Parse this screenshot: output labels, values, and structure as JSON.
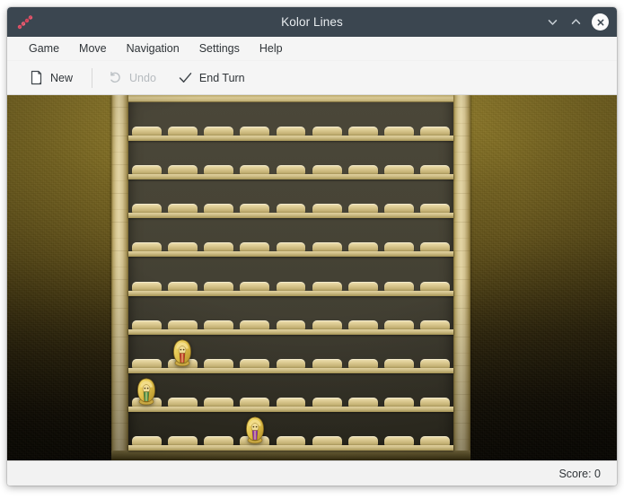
{
  "window": {
    "title": "Kolor Lines",
    "app_icon": "kolor-lines-dots-icon",
    "controls": {
      "minimize": "chevron-down-icon",
      "maximize": "chevron-up-icon",
      "close": "close-icon"
    }
  },
  "menubar": {
    "items": [
      {
        "label": "Game"
      },
      {
        "label": "Move"
      },
      {
        "label": "Navigation"
      },
      {
        "label": "Settings"
      },
      {
        "label": "Help"
      }
    ]
  },
  "toolbar": {
    "buttons": [
      {
        "label": "New",
        "icon": "document-new-icon",
        "enabled": true
      },
      {
        "label": "Undo",
        "icon": "undo-arrow-icon",
        "enabled": false
      },
      {
        "label": "End Turn",
        "icon": "checkmark-icon",
        "enabled": true
      }
    ]
  },
  "board": {
    "rows": 9,
    "columns": 9,
    "theme": "egyptian",
    "colors": {
      "frame_wood": "#d8c894",
      "shelf_back": "#474436",
      "pedestal": "#ddcb93",
      "background_top": "#8a7526",
      "background_bottom": "#110d04"
    },
    "pieces": [
      {
        "row": 6,
        "col": 1,
        "color": "red",
        "hex": "#c4342a",
        "shape": "pharaoh-bust"
      },
      {
        "row": 7,
        "col": 0,
        "color": "green",
        "hex": "#3f8f4e",
        "shape": "pharaoh-bust"
      },
      {
        "row": 8,
        "col": 3,
        "color": "purple",
        "hex": "#8e2bb8",
        "shape": "pharaoh-bust"
      }
    ]
  },
  "statusbar": {
    "score_label": "Score: 0"
  }
}
